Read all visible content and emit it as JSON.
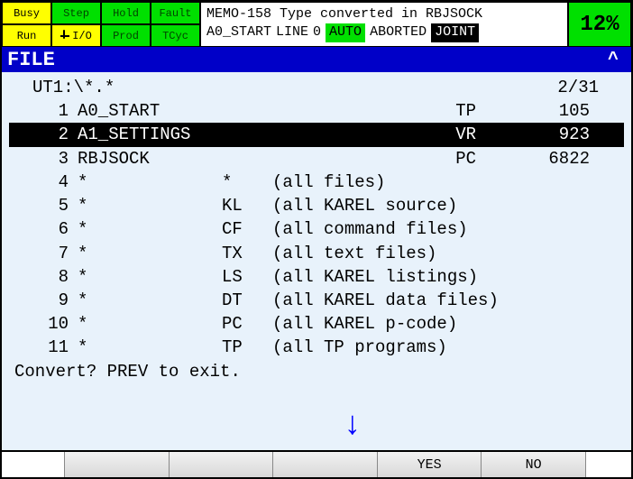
{
  "status": {
    "leds": {
      "busy": "Busy",
      "step": "Step",
      "hold": "Hold",
      "fault": "Fault",
      "run": "Run",
      "io": "I/O",
      "prod": "Prod",
      "tcyc": "TCyc"
    },
    "msg_line1": "MEMO-158 Type converted in RBJSOCK",
    "prog": "A0_START",
    "line_label": "LINE",
    "line_num": "0",
    "auto": "AUTO",
    "state": "ABORTED",
    "mode": "JOINT",
    "percent": "12%"
  },
  "title": "FILE",
  "listing": {
    "path": "UT1:\\*.*",
    "counter": "2/31",
    "rows": [
      {
        "num": "1",
        "name": "A0_START",
        "type": "",
        "desc": "",
        "col4": "TP",
        "size": "105",
        "file": true
      },
      {
        "num": "2",
        "name": "A1_SETTINGS",
        "type": "",
        "desc": "",
        "col4": "VR",
        "size": "923",
        "file": true,
        "selected": true
      },
      {
        "num": "3",
        "name": "RBJSOCK",
        "type": "",
        "desc": "",
        "col4": "PC",
        "size": "6822",
        "file": true
      },
      {
        "num": "4",
        "name": "*",
        "type": "*",
        "desc": "(all files)"
      },
      {
        "num": "5",
        "name": "*",
        "type": "KL",
        "desc": "(all KAREL source)"
      },
      {
        "num": "6",
        "name": "*",
        "type": "CF",
        "desc": "(all command files)"
      },
      {
        "num": "7",
        "name": "*",
        "type": "TX",
        "desc": "(all text files)"
      },
      {
        "num": "8",
        "name": "*",
        "type": "LS",
        "desc": "(all KAREL listings)"
      },
      {
        "num": "9",
        "name": "*",
        "type": "DT",
        "desc": "(all KAREL data files)"
      },
      {
        "num": "10",
        "name": "*",
        "type": "PC",
        "desc": "(all KAREL p-code)"
      },
      {
        "num": "11",
        "name": "*",
        "type": "TP",
        "desc": "(all TP programs)"
      }
    ],
    "prompt": "Convert? PREV to exit."
  },
  "softkeys": {
    "f1": "",
    "f2": "",
    "f3": "",
    "f4": "YES",
    "f5": "NO"
  }
}
